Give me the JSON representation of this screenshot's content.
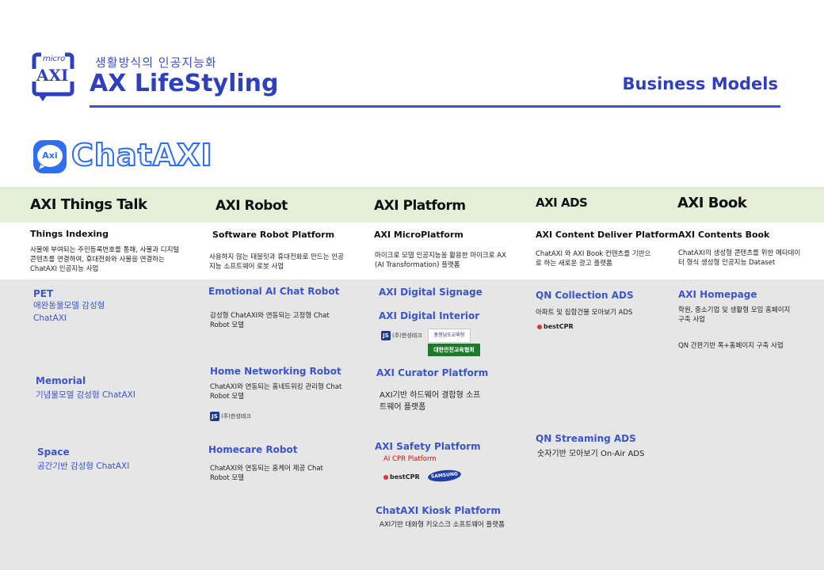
{
  "header": {
    "logo_micro": "micro",
    "logo_axi": "AXI",
    "subtitle": "생활방식의 인공지능화",
    "title": "AX LifeStyling",
    "right_title": "Business Models"
  },
  "brand": {
    "icon_text": "Axi",
    "name": "ChatAXI"
  },
  "colors": {
    "accent": "#2e3fbf",
    "band": "#e4efd8",
    "grey_area": "#e6e6e6",
    "item_blue": "#3c55c9",
    "highlight_red": "#d01010"
  },
  "columns": [
    {
      "category": "AXI Things Talk",
      "sub": "Things Indexing",
      "desc": "사물에 부여되는 주민등록번호를 통해, 사물과 디지털 콘텐츠를 연결하여, 휴대전화와 사물을 연결하는 ChatAXI 인공지능 사업",
      "items": [
        {
          "title": "PET",
          "sub": "애완동물모델 감성형 ChatAXI"
        },
        {
          "title": "Memorial",
          "sub": "기념물모델  감성형 ChatAXI"
        },
        {
          "title": "Space",
          "sub": "공간기반  감성형 ChatAXI"
        }
      ]
    },
    {
      "category": "AXI Robot",
      "sub": "Software Robot Platform",
      "desc": "사용하지 않는 태블릿과 휴대전화로 만드는 인공지능 소프트웨어 로봇 사업",
      "items": [
        {
          "title": "Emotional AI Chat Robot",
          "desc": "감성형 ChatAXI와 연동되는 고정형 Chat Robot 모델"
        },
        {
          "title": "Home Networking Robot",
          "desc": "ChatAXI와 연동되는 홈네트워킹 관리형 Chat Robot 모델",
          "logo": "(주)한성테크"
        },
        {
          "title": "Homecare Robot",
          "desc": "ChatAXI와 연동되는 홈케어 제공 Chat Robot 모델"
        }
      ]
    },
    {
      "category": "AXI Platform",
      "sub": "AXI MicroPlatform",
      "desc": "마이크로 모델 인공지능을 활용한 마이크로 AX (AI Transformation) 플랫폼",
      "items": [
        {
          "title": "AXI Digital Signage"
        },
        {
          "title": "AXI Digital Interior",
          "logos": [
            "(주)한성테크",
            "충청남도교육청",
            "대한안전교육협회"
          ]
        },
        {
          "title": "AXI Curator Platform",
          "desc": "AXI기반 하드웨어 결합형 소프트웨어 플랫폼"
        },
        {
          "title": "AXI Safety Platform",
          "red": "AI CPR Platform",
          "logos": [
            "bestCPR",
            "SAMSUNG"
          ]
        },
        {
          "title": "ChatAXI Kiosk Platform",
          "desc": "AXI기반 대화형 키오스크 소프트웨어 플랫폼"
        }
      ]
    },
    {
      "category": "AXI ADS",
      "sub": "AXI Content Deliver Platform",
      "desc": "ChatAXI 와 AXI Book 컨텐츠를 기반으로 하는 새로운 광고 플랫폼",
      "items": [
        {
          "title": "QN Collection ADS",
          "desc": "아파트 및 집합건물 모아보기 ADS",
          "logo": "bestCPR"
        },
        {
          "title": "QN Streaming ADS",
          "desc": "숫자기반 모아보기 On-Air ADS"
        }
      ]
    },
    {
      "category": "AXI Book",
      "sub": "AXI Contents Book",
      "desc": "ChatAXI의 생성형 콘텐츠를 위한   메타데이터 형식 생성형 인공지능 Dataset",
      "items": [
        {
          "title": "AXI Homepage",
          "desc": "학원, 중소기업 및 생활형 모임 홈페이지 구축 사업",
          "note": "QN 간판기반 폭+홈페이지 구축 사업"
        }
      ]
    }
  ]
}
